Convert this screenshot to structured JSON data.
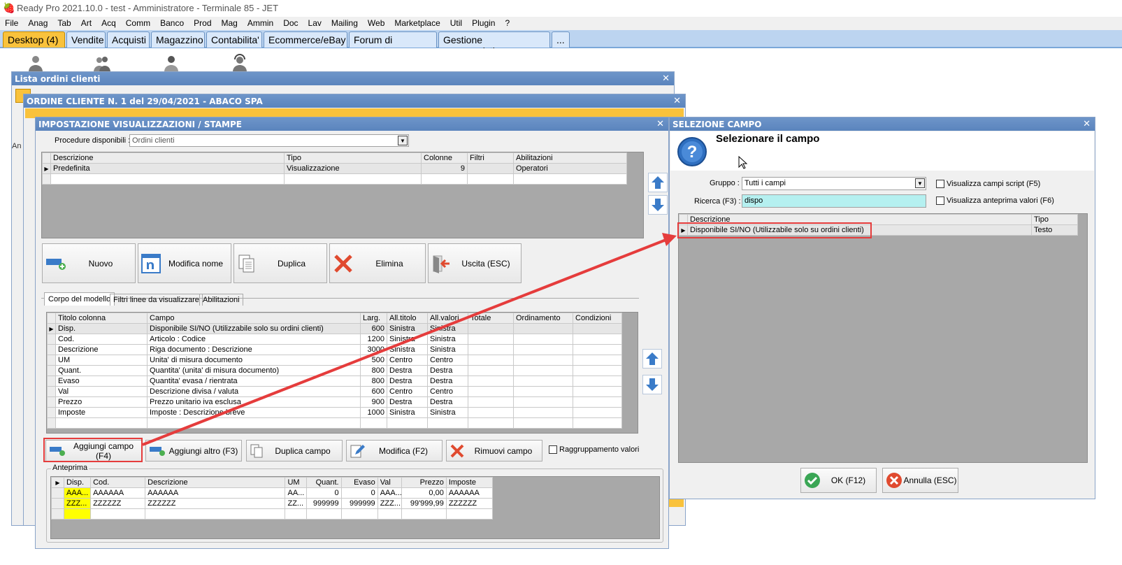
{
  "app": {
    "title": "Ready Pro 2021.10.0 - test - Amministratore - Terminale 85 - JET"
  },
  "menu": [
    "File",
    "Anag",
    "Tab",
    "Art",
    "Acq",
    "Comm",
    "Banco",
    "Prod",
    "Mag",
    "Ammin",
    "Doc",
    "Lav",
    "Mailing",
    "Web",
    "Marketplace",
    "Util",
    "Plugin",
    "?"
  ],
  "tabs": [
    "Desktop (4)",
    "Vendite",
    "Acquisti",
    "Magazzino",
    "Contabilita'",
    "Ecommerce/eBay",
    "Forum di supporto",
    "Gestione messaggistica",
    "..."
  ],
  "win_lista": {
    "title": "Lista ordini clienti"
  },
  "win_ordine": {
    "title": "ORDINE CLIENTE N. 1 del 29/04/2021 - ABACO SPA"
  },
  "win_imp": {
    "title": "IMPOSTAZIONE VISUALIZZAZIONI / STAMPE",
    "proc_label": "Procedure disponibili :",
    "proc_value": "Ordini clienti",
    "top_cols": [
      "Descrizione",
      "Tipo",
      "Colonne",
      "Filtri",
      "Abilitazioni"
    ],
    "top_row": {
      "desc": "Predefinita",
      "tipo": "Visualizzazione",
      "colonne": "9",
      "filtri": "",
      "abil": "Operatori"
    },
    "buttons": {
      "nuovo": "Nuovo",
      "modifica": "Modifica nome",
      "duplica": "Duplica",
      "elimina": "Elimina",
      "uscita": "Uscita (ESC)"
    },
    "subtabs": [
      "Corpo del modello",
      "Filtri linee da visualizzare",
      "Abilitazioni"
    ],
    "grid_cols": [
      "Titolo colonna",
      "Campo",
      "Larg.",
      "All.titolo",
      "All.valori",
      "Totale",
      "Ordinamento",
      "Condizioni"
    ],
    "grid_rows": [
      [
        "Disp.",
        "Disponibile SI/NO (Utilizzabile solo su ordini clienti)",
        "600",
        "Sinistra",
        "Sinistra"
      ],
      [
        "Cod.",
        "Articolo : Codice",
        "1200",
        "Sinistra",
        "Sinistra"
      ],
      [
        "Descrizione",
        "Riga documento : Descrizione",
        "3000",
        "Sinistra",
        "Sinistra"
      ],
      [
        "UM",
        "Unita' di misura documento",
        "500",
        "Centro",
        "Centro"
      ],
      [
        "Quant.",
        "Quantita' (unita' di misura documento)",
        "800",
        "Destra",
        "Destra"
      ],
      [
        "Evaso",
        "Quantita' evasa / rientrata",
        "800",
        "Destra",
        "Destra"
      ],
      [
        "Val",
        "Descrizione divisa / valuta",
        "600",
        "Centro",
        "Centro"
      ],
      [
        "Prezzo",
        "Prezzo unitario iva esclusa",
        "900",
        "Destra",
        "Destra"
      ],
      [
        "Imposte",
        "Imposte : Descrizione breve",
        "1000",
        "Sinistra",
        "Sinistra"
      ]
    ],
    "bottom_buttons": {
      "aggiungi": "Aggiungi campo (F4)",
      "altro": "Aggiungi altro (F3)",
      "dupcampo": "Duplica campo",
      "modifica": "Modifica (F2)",
      "rimuovi": "Rimuovi campo"
    },
    "raggruppamento": "Raggruppamento valori",
    "anteprima_label": "Anteprima",
    "preview_cols": [
      "Disp.",
      "Cod.",
      "Descrizione",
      "UM",
      "Quant.",
      "Evaso",
      "Val",
      "Prezzo",
      "Imposte"
    ],
    "preview_rows": [
      [
        "AAA...",
        "AAAAAA",
        "AAAAAA",
        "AA...",
        "0",
        "0",
        "AAA...",
        "0,00",
        "AAAAAA"
      ],
      [
        "ZZZ...",
        "ZZZZZZ",
        "ZZZZZZ",
        "ZZ...",
        "999999",
        "999999",
        "ZZZ...",
        "99'999,99",
        "ZZZZZZ"
      ]
    ]
  },
  "win_sel": {
    "title": "SELEZIONE CAMPO",
    "heading": "Selezionare il campo",
    "gruppo_label": "Gruppo :",
    "gruppo_value": "Tutti i campi",
    "ricerca_label": "Ricerca (F3) :",
    "ricerca_value": "dispo",
    "chk_script": "Visualizza campi script (F5)",
    "chk_anteprima": "Visualizza anteprima valori (F6)",
    "cols": [
      "Descrizione",
      "Tipo"
    ],
    "row": {
      "desc": "Disponibile SI/NO (Utilizzabile solo su ordini clienti)",
      "tipo": "Testo"
    },
    "ok": "OK (F12)",
    "annulla": "Annulla (ESC)"
  },
  "colors": {
    "title_blue": "#5a84bd",
    "accent_yellow": "#f9c23c",
    "highlight_red": "#e53c3c",
    "search_cyan": "#b5f0f0"
  }
}
